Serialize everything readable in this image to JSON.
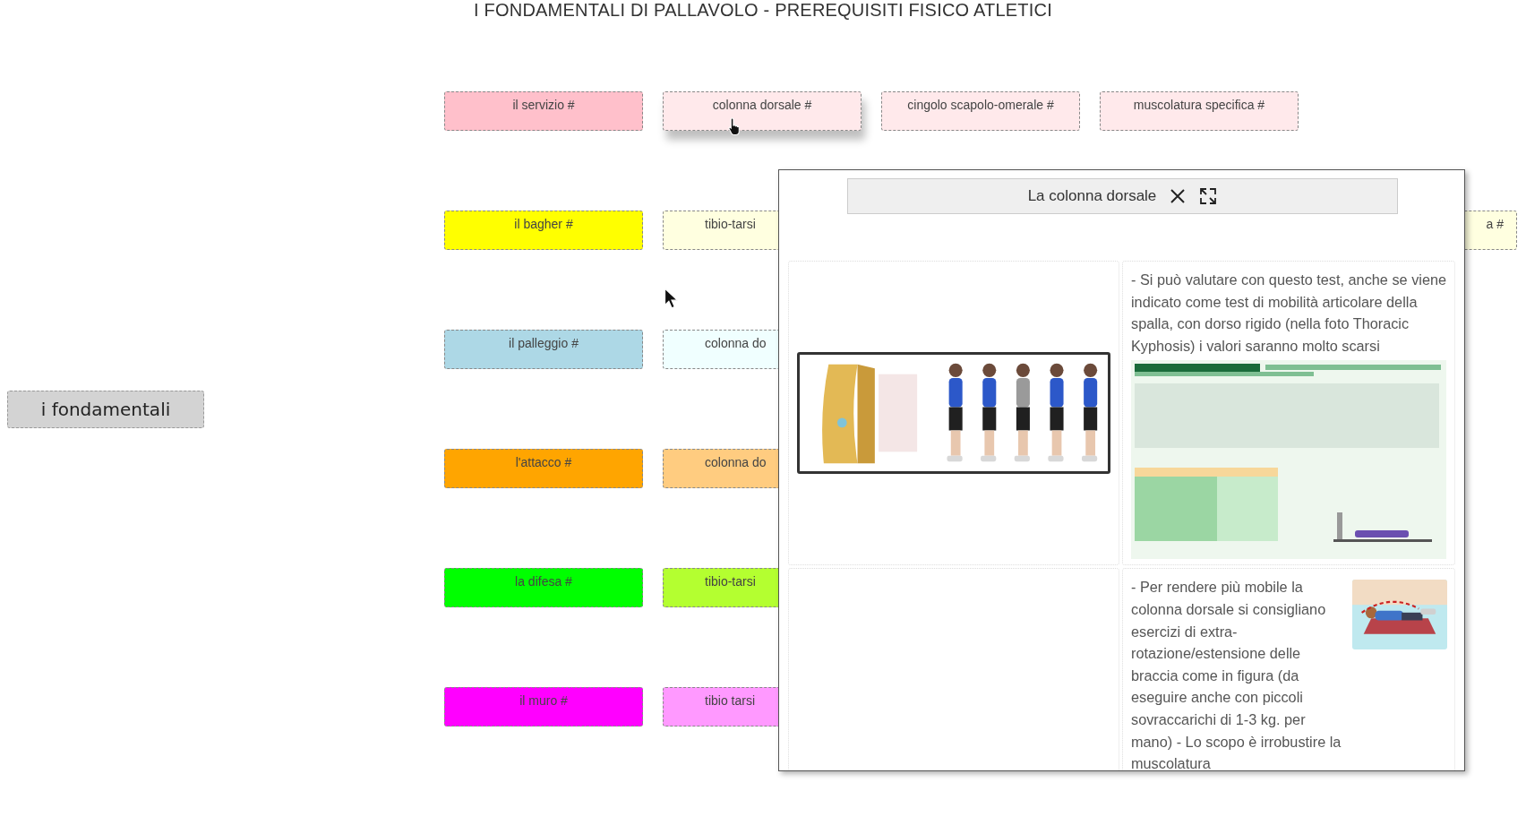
{
  "title": "I FONDAMENTALI DI PALLAVOLO - PREREQUISITI FISICO ATLETICI",
  "root": {
    "label": "i fondamentali"
  },
  "rows": [
    [
      {
        "label": "il servizio #",
        "color": "#ffc0cb",
        "kind": "full"
      },
      {
        "label": "colonna dorsale #",
        "color": "#ffe9eb",
        "kind": "full"
      },
      {
        "label": "cingolo scapolo-omerale #",
        "color": "#ffe9eb",
        "kind": "full"
      },
      {
        "label": "muscolatura specifica #",
        "color": "#ffe9eb",
        "kind": "full"
      }
    ],
    [
      {
        "label": "il bagher #",
        "color": "#ffff00",
        "kind": "full"
      },
      {
        "label": "tibio-tarsi",
        "color": "#ffffe0",
        "kind": "cut"
      }
    ],
    [
      {
        "label": "il palleggio #",
        "color": "#add8e6",
        "kind": "full"
      },
      {
        "label": "colonna do",
        "color": "#f0ffff",
        "kind": "cut"
      }
    ],
    [
      {
        "label": "l'attacco #",
        "color": "#ffa500",
        "kind": "full"
      },
      {
        "label": "colonna do",
        "color": "#ffcc80",
        "kind": "cut"
      }
    ],
    [
      {
        "label": "la difesa #",
        "color": "#00ff00",
        "kind": "full"
      },
      {
        "label": "tibio-tarsi",
        "color": "#b4ff30",
        "kind": "cut"
      }
    ],
    [
      {
        "label": "il muro #",
        "color": "#ff00ff",
        "kind": "full"
      },
      {
        "label": "tibio tarsi",
        "color": "#ff99ff",
        "kind": "cut"
      }
    ]
  ],
  "edge_node": {
    "label": "a #",
    "color": "#ffffe0"
  },
  "popup": {
    "title": "La colonna dorsale",
    "text_1": "- Si può valutare con questo test, anche se viene indicato come test di mobilità articolare della spalla, con dorso rigido (nella foto Thoracic Kyphosis) i valori saranno molto scarsi",
    "text_2": "- Per rendere più mobile la colonna dorsale si consigliano esercizi di extra-rotazione/estensione delle braccia come in figura (da eseguire anche con piccoli sovraccarichi di 1-3 kg. per mano) - Lo scopo è irrobustire la muscolatura"
  }
}
